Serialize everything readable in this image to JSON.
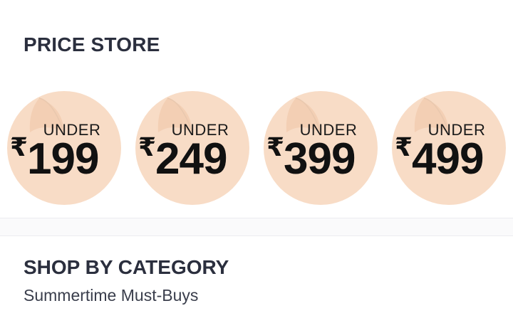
{
  "price_store": {
    "title": "PRICE STORE",
    "tiles": [
      {
        "label": "UNDER",
        "currency": "₹",
        "amount": "199"
      },
      {
        "label": "UNDER",
        "currency": "₹",
        "amount": "249"
      },
      {
        "label": "UNDER",
        "currency": "₹",
        "amount": "399"
      },
      {
        "label": "UNDER",
        "currency": "₹",
        "amount": "499"
      }
    ]
  },
  "category": {
    "title": "SHOP BY CATEGORY",
    "subtitle": "Summertime Must-Buys"
  },
  "colors": {
    "sticker": "#f8dcc6",
    "sticker_shadow": "#e9c8ae",
    "heading": "#2b2f3e"
  }
}
